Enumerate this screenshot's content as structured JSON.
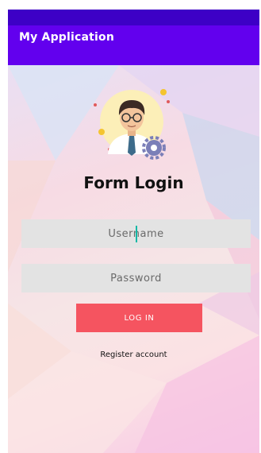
{
  "app_bar": {
    "title": "My Application"
  },
  "form": {
    "title": "Form Login",
    "username_placeholder": "Username",
    "password_placeholder": "Password",
    "login_label": "LOG IN",
    "register_label": "Register account"
  },
  "colors": {
    "status_bar": "#3d00c6",
    "app_bar": "#6200ee",
    "login_button": "#f55460",
    "field_background": "#e3e3e3",
    "cursor": "#14b8a6"
  }
}
